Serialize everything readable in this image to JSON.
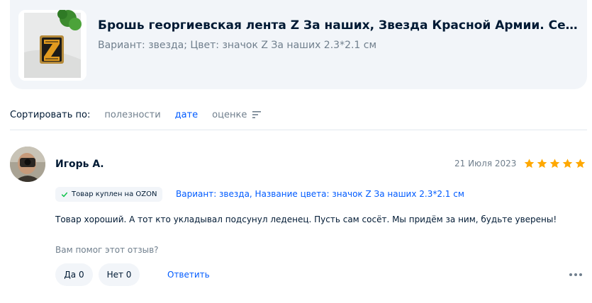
{
  "product": {
    "title": "Брошь георгиевская лента Z За наших, Звезда Красной Армии. Серп и…",
    "variant": "Вариант: звезда; Цвет: значок Z За наших 2.3*2.1 см",
    "image_icon": "product-brooch-image"
  },
  "sort": {
    "label": "Сортировать по:",
    "options": [
      "полезности",
      "дате",
      "оценке"
    ],
    "active": "дате",
    "icon": "sort-icon"
  },
  "review": {
    "author": "Игорь А.",
    "date": "21 Июля 2023",
    "rating": 5,
    "rating_max": 5,
    "star_color": "#ffa800",
    "purchase_badge": "Товар куплен на OZON",
    "badge_check_color": "#10c44c",
    "variant": "Вариант: звезда, Название цвета: значок Z За наших 2.3*2.1 см",
    "text": "Товар хороший. А тот кто укладывал подсунул леденец. Пусть сам сосёт. Мы придём за ним, будьте уверены!",
    "helpful_question": "Вам помог этот отзыв?",
    "yes_label": "Да 0",
    "no_label": "Нет 0",
    "reply_label": "Ответить"
  },
  "colors": {
    "accent": "#005bff",
    "text": "#001a34",
    "muted": "#707f8d",
    "surface": "#f2f5f9"
  }
}
